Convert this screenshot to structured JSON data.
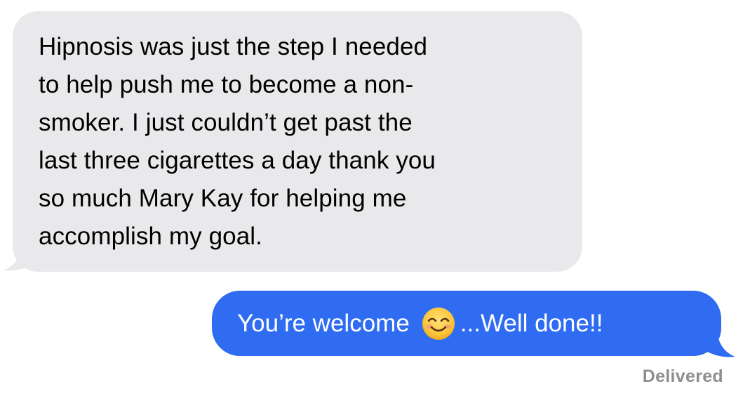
{
  "conversation": {
    "received_message": "Hipnosis was just the step I needed\nto help push me to become a non-\nsmoker. I just couldn’t get past the\nlast three cigarettes a day thank you\nso much Mary Kay for helping me\naccomplish my goal.",
    "sent_message": {
      "before_emoji": "You’re welcome",
      "emoji": "smiling-face-with-smiling-eyes",
      "after_emoji": "...Well done!!"
    },
    "status": "Delivered"
  },
  "colors": {
    "received_bubble": "#e9e9eb",
    "sent_bubble": "#2f6cf2",
    "status_text": "#8e8e93"
  }
}
